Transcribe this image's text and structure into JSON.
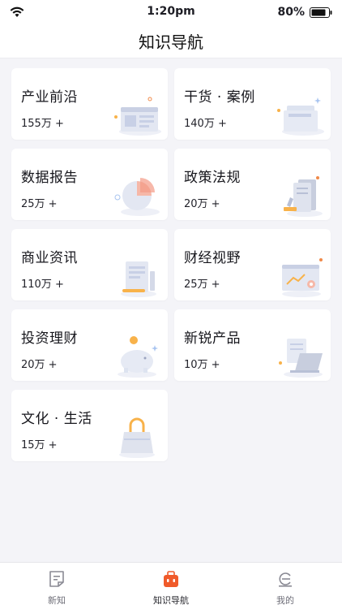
{
  "status": {
    "time": "1:20pm",
    "battery": "80%"
  },
  "nav": {
    "title": "知识导航"
  },
  "cards": [
    {
      "title": "产业前沿",
      "count": "155万 +",
      "icon": "browser-document-icon"
    },
    {
      "title": "干货 · 案例",
      "count": "140万 +",
      "icon": "folder-files-icon"
    },
    {
      "title": "数据报告",
      "count": "25万 +",
      "icon": "pie-chart-icon"
    },
    {
      "title": "政策法规",
      "count": "20万 +",
      "icon": "document-stamp-icon"
    },
    {
      "title": "商业资讯",
      "count": "110万 +",
      "icon": "scroll-document-icon"
    },
    {
      "title": "财经视野",
      "count": "25万 +",
      "icon": "trend-screen-icon"
    },
    {
      "title": "投资理财",
      "count": "20万 +",
      "icon": "piggy-bank-icon"
    },
    {
      "title": "新锐产品",
      "count": "10万 +",
      "icon": "laptop-icon"
    },
    {
      "title": "文化 · 生活",
      "count": "15万 +",
      "icon": "shopping-bag-icon"
    }
  ],
  "tabs": [
    {
      "label": "新知",
      "icon": "document-icon"
    },
    {
      "label": "知识导航",
      "icon": "toolbox-icon"
    },
    {
      "label": "我的",
      "icon": "profile-icon"
    }
  ],
  "colors": {
    "accent": "#f05a2a",
    "icon_gray": "#8a8a94",
    "illus_blue": "#c8d0e6",
    "illus_orange": "#f8b24a"
  }
}
